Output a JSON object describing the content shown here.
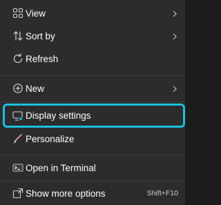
{
  "menu": {
    "items": [
      {
        "label": "View",
        "icon": "view-grid-icon",
        "submenu": true
      },
      {
        "label": "Sort by",
        "icon": "sort-arrows-icon",
        "submenu": true
      },
      {
        "label": "Refresh",
        "icon": "refresh-icon",
        "submenu": false
      },
      {
        "label": "New",
        "icon": "new-plus-circle-icon",
        "submenu": true
      },
      {
        "label": "Display settings",
        "icon": "display-settings-icon",
        "submenu": false,
        "highlighted": true
      },
      {
        "label": "Personalize",
        "icon": "personalize-pen-icon",
        "submenu": false
      },
      {
        "label": "Open in Terminal",
        "icon": "terminal-icon",
        "submenu": false
      },
      {
        "label": "Show more options",
        "icon": "show-more-options-icon",
        "submenu": false,
        "shortcut": "Shift+F10"
      }
    ]
  },
  "colors": {
    "background": "#2c2c2c",
    "text": "#ffffff",
    "icon": "#d6d6d6",
    "accent": "#19c2e0",
    "pen": "#e8a2b8"
  }
}
